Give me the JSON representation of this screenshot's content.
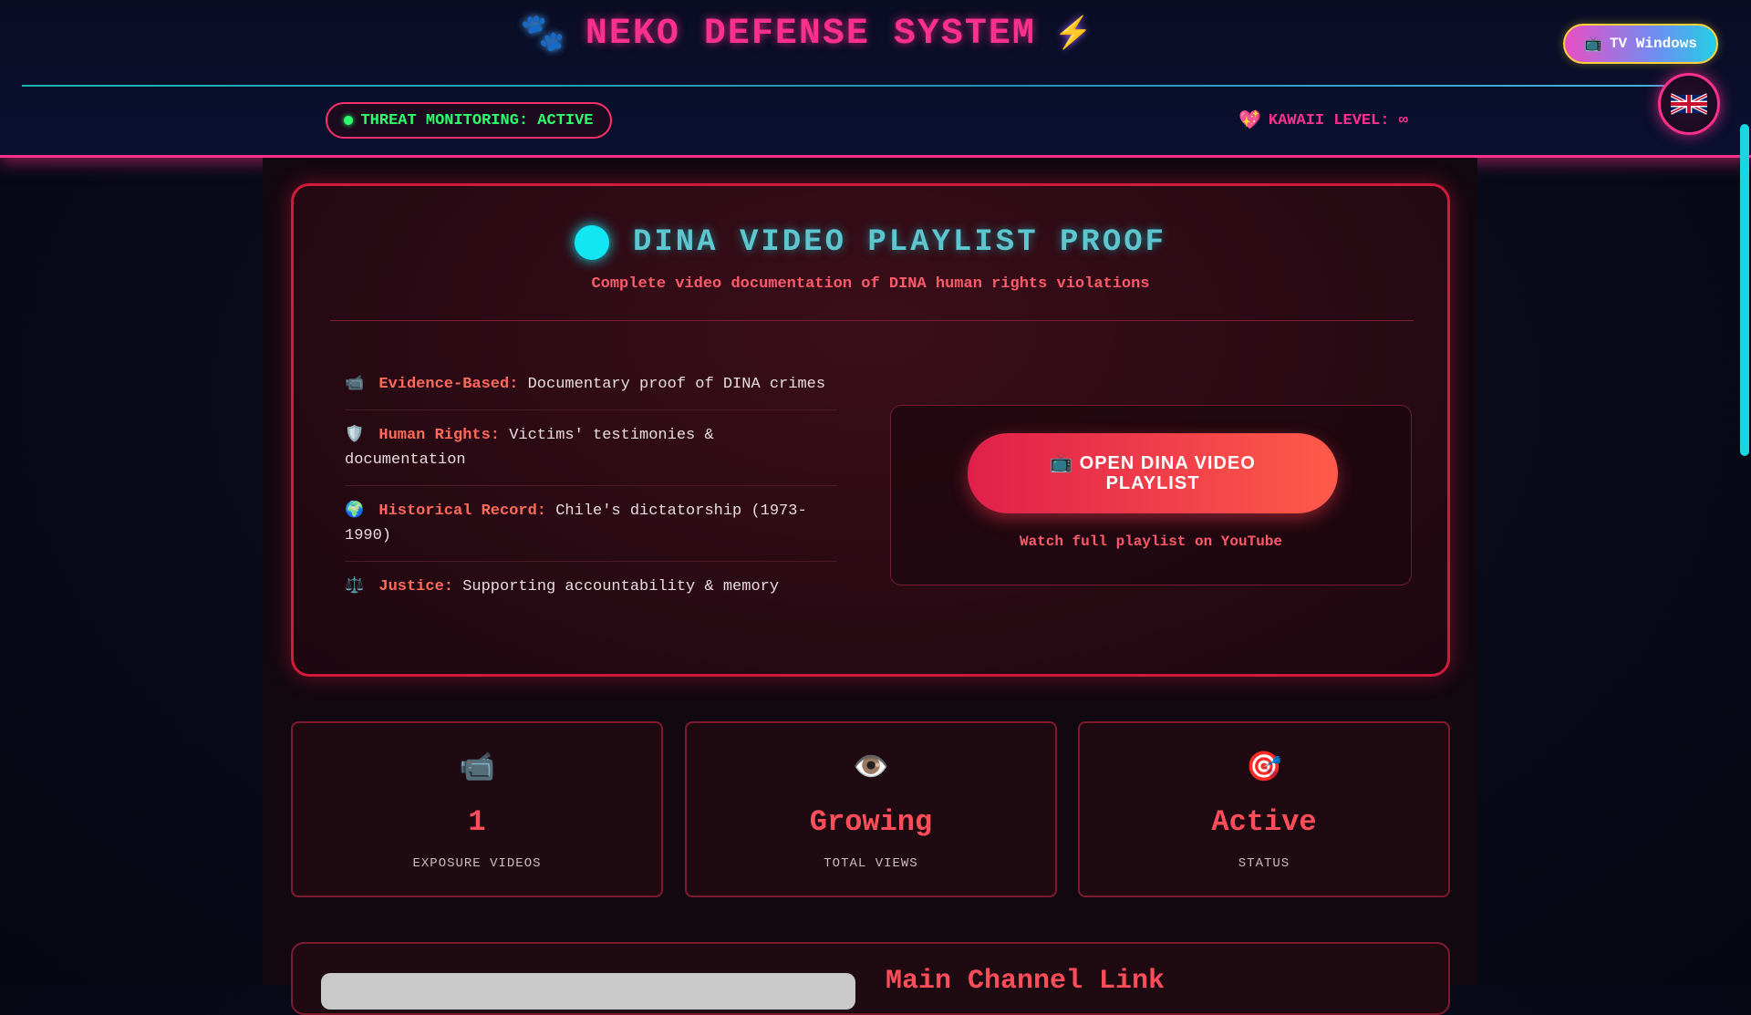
{
  "header": {
    "title": "NEKO DEFENSE SYSTEM",
    "paw_icon": "🐾",
    "bolt_icon": "⚡",
    "threat_status": "THREAT MONITORING: ACTIVE",
    "kawaii_icon": "💖",
    "kawaii_level": "KAWAII LEVEL: ∞",
    "tv_icon": "📺",
    "tv_button": "TV Windows",
    "language_flag": "🇬🇧"
  },
  "proof": {
    "title": "DINA VIDEO PLAYLIST PROOF",
    "subtitle": "Complete video documentation of DINA human rights violations",
    "features": [
      {
        "icon": "📹",
        "label": "Evidence-Based:",
        "text": "Documentary proof of DINA crimes"
      },
      {
        "icon": "🛡️",
        "label": "Human Rights:",
        "text": "Victims' testimonies & documentation"
      },
      {
        "icon": "🌍",
        "label": "Historical Record:",
        "text": "Chile's dictatorship (1973-1990)"
      },
      {
        "icon": "⚖️",
        "label": "Justice:",
        "text": "Supporting accountability & memory"
      }
    ],
    "cta_icon": "📺",
    "cta_button": "OPEN DINA VIDEO PLAYLIST",
    "cta_caption": "Watch full playlist on YouTube"
  },
  "stats": [
    {
      "icon": "📹",
      "value": "1",
      "label": "EXPOSURE VIDEOS"
    },
    {
      "icon": "👁️",
      "value": "Growing",
      "label": "TOTAL VIEWS"
    },
    {
      "icon": "🎯",
      "value": "Active",
      "label": "STATUS"
    }
  ],
  "channel": {
    "title": "Main Channel Link"
  },
  "colors": {
    "accent_pink": "#ff2f8e",
    "accent_red": "#ff4d5a",
    "accent_cyan": "#12e6f2",
    "status_green": "#2bff6c"
  }
}
